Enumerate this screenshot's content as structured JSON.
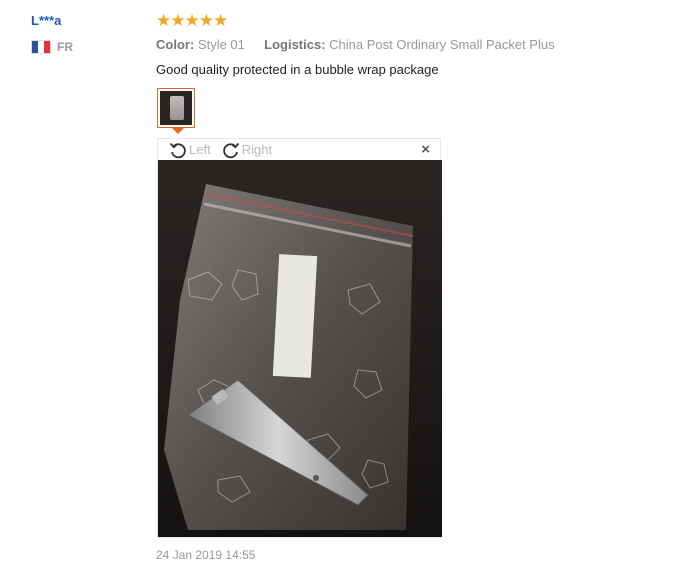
{
  "review": {
    "user": "L***a",
    "country_code": "FR",
    "rating": 5,
    "stars": "★★★★★",
    "color_label": "Color:",
    "color_value": "Style 01",
    "logistics_label": "Logistics:",
    "logistics_value": "China Post Ordinary Small Packet Plus",
    "text": "Good quality protected in a bubble wrap package",
    "date": "24 Jan 2019 14:55"
  },
  "viewer": {
    "rotate_left_label": "Left",
    "rotate_right_label": "Right",
    "close_glyph": "×"
  },
  "colors": {
    "star": "#f5a623",
    "username": "#1a5bb4",
    "thumb_border": "#e86a1f"
  },
  "icons": [
    "rotate-left-icon",
    "rotate-right-icon",
    "close-icon",
    "flag-france-icon",
    "star-icon"
  ]
}
